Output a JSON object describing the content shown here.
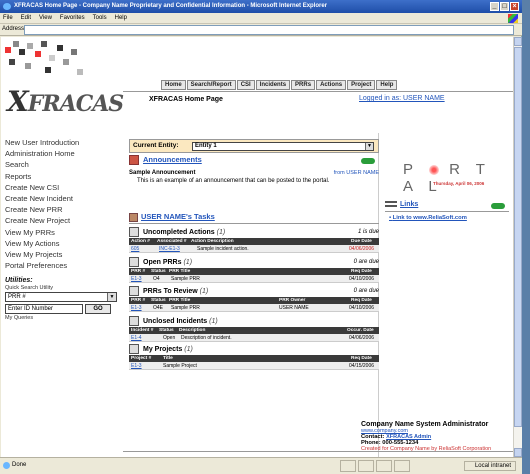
{
  "window": {
    "title": "XFRACAS Home Page - Company Name Proprietary and Confidential Information - Microsoft Internet Explorer",
    "menus": [
      "File",
      "Edit",
      "View",
      "Favorites",
      "Tools",
      "Help"
    ],
    "address_label": "Address"
  },
  "status": {
    "text": "Done",
    "zone": "Local intranet"
  },
  "header": {
    "logo_text": "FRACAS",
    "logo_x": "X",
    "nav": [
      "Home",
      "Search/Report",
      "CSI",
      "Incidents",
      "PRRs",
      "Actions",
      "Project",
      "Help"
    ],
    "page_title": "XFRACAS Home Page",
    "logged_in": "Logged in as: USER NAME"
  },
  "sidebar": {
    "links": [
      "New User Introduction",
      "Administration Home",
      "Search",
      "Reports",
      "Create New CSI",
      "Create New Incident",
      "Create New PRR",
      "Create New Project",
      "View My PRRs",
      "View My Actions",
      "View My Projects",
      "Portal Preferences"
    ],
    "utilities": {
      "title": "Utilities:",
      "quick_search": "Quick Search Utility",
      "select_value": "PRR #",
      "input_value": "Enter ID Number",
      "go": "GO",
      "my_queries": "My Queries"
    }
  },
  "entity": {
    "label": "Current Entity:",
    "value": "Entity 1"
  },
  "announcements": {
    "title": "Announcements",
    "item_title": "Sample Announcement",
    "from": "from USER NAME",
    "body": "This is an example of an announcement that can be posted to the portal."
  },
  "tasks": {
    "title": "USER NAME's Tasks",
    "sections": [
      {
        "title": "Uncompleted Actions",
        "count": "(1)",
        "due": "1 is due",
        "headers": [
          "Action #",
          "Associated #",
          "Action Description",
          "Due Date"
        ],
        "rows": [
          [
            "605",
            "INC-E1-3",
            "Sample incident action.",
            "04/06/2006"
          ]
        ]
      },
      {
        "title": "Open PRRs",
        "count": "(1)",
        "due": "0 are due",
        "headers": [
          "PRR #",
          "Status",
          "PRR Title",
          "Req Date"
        ],
        "rows": [
          [
            "E1-3",
            "O4",
            "Sample PRR",
            "04/10/2006"
          ]
        ]
      },
      {
        "title": "PRRs To Review",
        "count": "(1)",
        "due": "0 are due",
        "headers": [
          "PRR #",
          "Status",
          "PRR Title",
          "PRR Owner",
          "Req Date"
        ],
        "rows": [
          [
            "E1-3",
            "O4E",
            "Sample PRR",
            "USER NAME",
            "04/10/2006"
          ]
        ]
      },
      {
        "title": "Unclosed Incidents",
        "count": "(1)",
        "due": "",
        "headers": [
          "Incident #",
          "Status",
          "Description",
          "Occur. Date"
        ],
        "rows": [
          [
            "E1-4",
            "Open",
            "Description of incident.",
            "04/06/2006"
          ]
        ]
      },
      {
        "title": "My Projects",
        "count": "(1)",
        "due": "",
        "headers": [
          "Project #",
          "Title",
          "Req Date"
        ],
        "rows": [
          [
            "E1-3",
            "Sample Project",
            "04/15/2006"
          ]
        ]
      }
    ]
  },
  "portal": {
    "word": "P O R T A L",
    "date": "Thursday, April 06, 2006",
    "links_title": "Links",
    "link_item": "Link to www.ReliaSoft.com"
  },
  "footer": {
    "title": "Company Name System Administrator",
    "site": "www.company.com",
    "contact_label": "Contact:",
    "contact": "XFRACAS Admin",
    "phone": "Phone: 000-555-1234",
    "created_by": "Created for Company Name by ReliaSoft Corporation"
  }
}
